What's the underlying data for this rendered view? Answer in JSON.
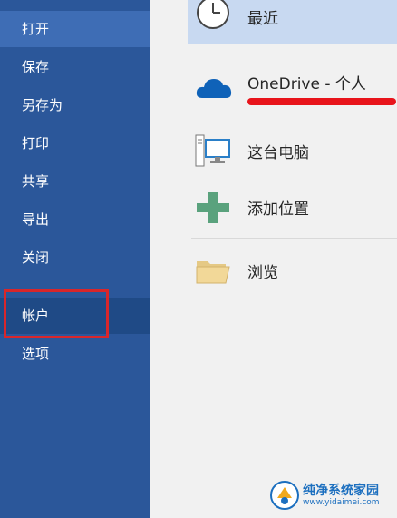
{
  "sidebar": {
    "items": [
      {
        "label": "打开"
      },
      {
        "label": "保存"
      },
      {
        "label": "另存为"
      },
      {
        "label": "打印"
      },
      {
        "label": "共享"
      },
      {
        "label": "导出"
      },
      {
        "label": "关闭"
      },
      {
        "label": "帐户"
      },
      {
        "label": "选项"
      }
    ]
  },
  "places": {
    "recent": {
      "label": "最近",
      "icon": "clock-icon"
    },
    "onedrive": {
      "label": "OneDrive - 个人",
      "icon": "cloud-icon"
    },
    "this_pc": {
      "label": "这台电脑",
      "icon": "computer-icon"
    },
    "add_place": {
      "label": "添加位置",
      "icon": "plus-icon"
    },
    "browse": {
      "label": "浏览",
      "icon": "folder-icon"
    }
  },
  "watermark": {
    "title": "纯净系统家园",
    "url": "www.yidaimei.com"
  },
  "colors": {
    "sidebar": "#2b579a",
    "highlight": "#c8d9f1",
    "annotation": "#d9262a"
  }
}
